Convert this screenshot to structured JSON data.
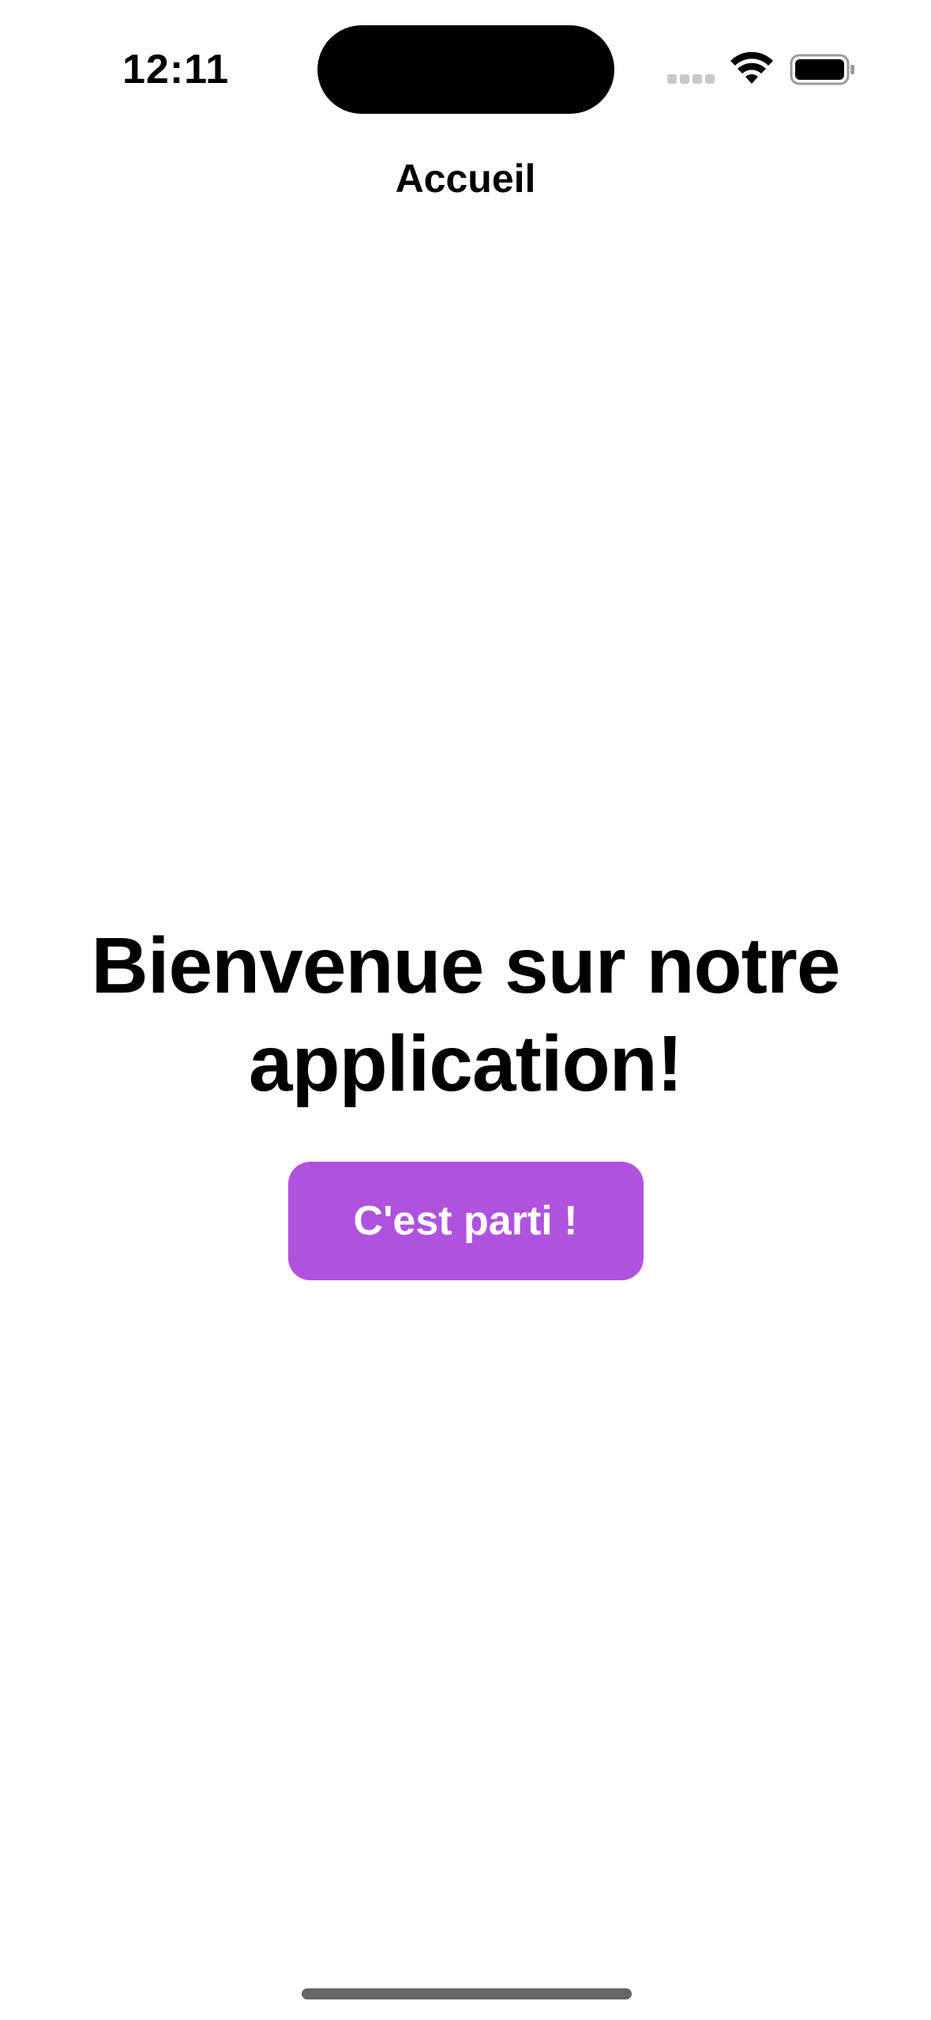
{
  "status_bar": {
    "time": "12:11",
    "icons": [
      "signal-icon",
      "wifi-icon",
      "battery-icon"
    ]
  },
  "navigation": {
    "title": "Accueil"
  },
  "main": {
    "heading": "Bienvenue sur notre application!",
    "start_button_label": "C'est parti !"
  },
  "colors": {
    "accent": "#AF52DE",
    "background": "#FFFFFF",
    "text": "#000000"
  }
}
